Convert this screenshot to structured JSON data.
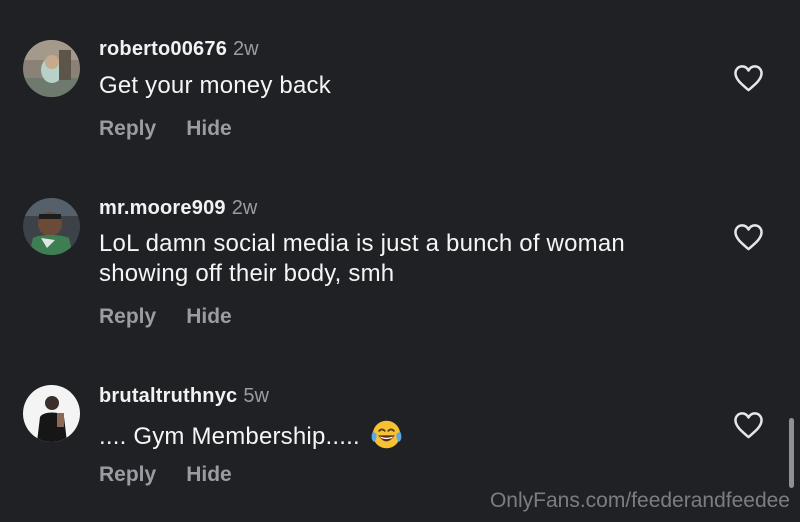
{
  "comments": [
    {
      "username": "roberto00676",
      "time": "2w",
      "text": "Get your money back",
      "reply_label": "Reply",
      "hide_label": "Hide",
      "emoji": ""
    },
    {
      "username": "mr.moore909",
      "time": "2w",
      "text": "LoL damn social media is just a bunch of woman showing off their body, smh",
      "reply_label": "Reply",
      "hide_label": "Hide",
      "emoji": ""
    },
    {
      "username": "brutaltruthnyc",
      "time": "5w",
      "text": ".... Gym Membership.....",
      "reply_label": "Reply",
      "hide_label": "Hide",
      "emoji": "face-with-tears-of-joy"
    }
  ],
  "watermark": "OnlyFans.com/feederandfeedee",
  "colors": {
    "background": "#1f2125",
    "primary_text": "#f2f2f2",
    "secondary_text": "#9a9ca3"
  },
  "icons": {
    "like": "heart-outline-icon",
    "emoji": "face-with-tears-of-joy-icon"
  }
}
